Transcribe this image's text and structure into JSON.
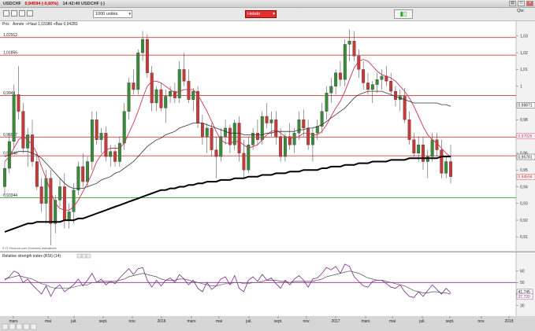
{
  "window": {
    "symbol": "USDCHF",
    "price": "0,94594",
    "change": "(-0,60%)",
    "time": "14:42:40 USDCHF",
    "suffix": "(-)",
    "quote_label": "Qte",
    "icons": [
      "chart-icon",
      "maximize-icon",
      "close-icon"
    ]
  },
  "toolbar": {
    "units_value": "1000 unités",
    "period_value": "Hebdo",
    "chart_button_icon": "candlestick-chart-icon"
  },
  "main_chart": {
    "panel_label": "Prix",
    "legend_text": "Année :+Haut 1,03386 +Bas 0,94283",
    "source_note": "© IT-Finance.com Données indicatives",
    "y_ticks": [
      {
        "v": 1.03,
        "label": "1,03"
      },
      {
        "v": 1.02,
        "label": "1,02"
      },
      {
        "v": 1.01,
        "label": "1,01"
      },
      {
        "v": 1.0,
        "label": "1"
      },
      {
        "v": 0.98,
        "label": "0,98"
      },
      {
        "v": 0.96,
        "label": "0,96"
      },
      {
        "v": 0.95,
        "label": "0,95"
      },
      {
        "v": 0.94,
        "label": "0,94"
      },
      {
        "v": 0.93,
        "label": "0,93"
      },
      {
        "v": 0.92,
        "label": "0,92"
      },
      {
        "v": 0.91,
        "label": "0,91"
      }
    ],
    "h_lines": [
      {
        "v": 1.02912,
        "label": "1,02912",
        "color": "#d23c3c"
      },
      {
        "v": 1.01856,
        "label": "1,01856",
        "color": "#d23c3c"
      },
      {
        "v": 0.9944,
        "label": "0,9944",
        "color": "#d23c3c"
      },
      {
        "v": 0.96967,
        "label": "0,96967",
        "color": "#d23c3c"
      },
      {
        "v": 0.95846,
        "label": "0,95846",
        "color": "#d23c3c"
      },
      {
        "v": 0.93344,
        "label": "0,93344",
        "color": "#3aa53a"
      }
    ],
    "right_badges": [
      {
        "v": 0.98871,
        "label": "0,98871",
        "bg": "#ffffff",
        "fg": "#222222"
      },
      {
        "v": 0.97026,
        "label": "0,97026",
        "bg": "#ffffff",
        "fg": "#cc2255"
      },
      {
        "v": 0.95781,
        "label": "0,95781",
        "bg": "#ffffff",
        "fg": "#222222"
      },
      {
        "v": 0.94594,
        "label": "0,94594",
        "bg": "#ffffff",
        "fg": "#cc2222"
      }
    ]
  },
  "chart_data": {
    "type": "candlestick",
    "title": "USDCHF",
    "xlabel": "",
    "ylabel": "",
    "ylim": [
      0.905,
      1.036
    ],
    "x": [
      "mars 2015",
      "mai",
      "juil.",
      "sept.",
      "nov.",
      "2016",
      "mars",
      "mai",
      "juil.",
      "sept.",
      "nov.",
      "2017",
      "mars",
      "mai",
      "juil.",
      "sept.",
      "nov.",
      "2018"
    ],
    "candles": [
      [
        0.94,
        0.955,
        0.935,
        0.951
      ],
      [
        0.951,
        0.972,
        0.948,
        0.967
      ],
      [
        0.967,
        1.001,
        0.963,
        0.995
      ],
      [
        0.995,
        1.012,
        0.98,
        0.985
      ],
      [
        0.985,
        0.99,
        0.96,
        0.963
      ],
      [
        0.963,
        0.975,
        0.952,
        0.971
      ],
      [
        0.971,
        0.98,
        0.952,
        0.955
      ],
      [
        0.955,
        0.96,
        0.938,
        0.94
      ],
      [
        0.94,
        0.945,
        0.925,
        0.93
      ],
      [
        0.93,
        0.95,
        0.918,
        0.945
      ],
      [
        0.945,
        0.95,
        0.905,
        0.918
      ],
      [
        0.918,
        0.935,
        0.912,
        0.932
      ],
      [
        0.932,
        0.945,
        0.928,
        0.94
      ],
      [
        0.94,
        0.948,
        0.915,
        0.92
      ],
      [
        0.92,
        0.93,
        0.915,
        0.925
      ],
      [
        0.925,
        0.942,
        0.918,
        0.938
      ],
      [
        0.938,
        0.955,
        0.935,
        0.952
      ],
      [
        0.952,
        0.96,
        0.94,
        0.943
      ],
      [
        0.943,
        0.958,
        0.94,
        0.955
      ],
      [
        0.955,
        0.985,
        0.95,
        0.98
      ],
      [
        0.98,
        0.985,
        0.965,
        0.968
      ],
      [
        0.968,
        0.975,
        0.96,
        0.972
      ],
      [
        0.972,
        0.976,
        0.955,
        0.958
      ],
      [
        0.958,
        0.965,
        0.952,
        0.961
      ],
      [
        0.961,
        0.965,
        0.952,
        0.955
      ],
      [
        0.955,
        0.97,
        0.952,
        0.966
      ],
      [
        0.966,
        0.99,
        0.962,
        0.985
      ],
      [
        0.985,
        1.005,
        0.98,
        1.002
      ],
      [
        1.002,
        1.01,
        0.995,
        0.998
      ],
      [
        0.998,
        1.022,
        0.995,
        1.02
      ],
      [
        1.02,
        1.033,
        1.015,
        1.028
      ],
      [
        1.028,
        1.031,
        1.005,
        1.008
      ],
      [
        1.008,
        1.012,
        0.985,
        0.99
      ],
      [
        0.99,
        1.0,
        0.985,
        0.998
      ],
      [
        0.998,
        1.002,
        0.985,
        0.987
      ],
      [
        0.987,
        0.998,
        0.978,
        0.994
      ],
      [
        0.994,
        1.0,
        0.99,
        0.997
      ],
      [
        0.997,
        1.002,
        0.99,
        0.993
      ],
      [
        0.993,
        1.015,
        0.99,
        1.01
      ],
      [
        1.01,
        1.02,
        1.0,
        1.003
      ],
      [
        1.003,
        1.01,
        0.99,
        0.992
      ],
      [
        0.992,
        0.999,
        0.985,
        0.997
      ],
      [
        0.997,
        1.0,
        0.975,
        0.978
      ],
      [
        0.978,
        0.983,
        0.965,
        0.97
      ],
      [
        0.97,
        0.978,
        0.96,
        0.975
      ],
      [
        0.975,
        0.978,
        0.958,
        0.962
      ],
      [
        0.962,
        0.97,
        0.945,
        0.958
      ],
      [
        0.958,
        0.975,
        0.955,
        0.97
      ],
      [
        0.97,
        0.98,
        0.965,
        0.975
      ],
      [
        0.975,
        0.977,
        0.96,
        0.965
      ],
      [
        0.965,
        0.98,
        0.962,
        0.978
      ],
      [
        0.978,
        0.982,
        0.955,
        0.96
      ],
      [
        0.96,
        0.968,
        0.945,
        0.95
      ],
      [
        0.95,
        0.97,
        0.948,
        0.965
      ],
      [
        0.965,
        0.975,
        0.962,
        0.972
      ],
      [
        0.972,
        0.98,
        0.965,
        0.968
      ],
      [
        0.968,
        0.985,
        0.965,
        0.982
      ],
      [
        0.982,
        0.99,
        0.975,
        0.978
      ],
      [
        0.978,
        0.985,
        0.97,
        0.98
      ],
      [
        0.98,
        0.985,
        0.965,
        0.97
      ],
      [
        0.97,
        0.975,
        0.955,
        0.958
      ],
      [
        0.958,
        0.972,
        0.955,
        0.97
      ],
      [
        0.97,
        0.978,
        0.962,
        0.965
      ],
      [
        0.965,
        0.975,
        0.96,
        0.972
      ],
      [
        0.972,
        0.985,
        0.968,
        0.98
      ],
      [
        0.98,
        0.986,
        0.97,
        0.975
      ],
      [
        0.975,
        0.98,
        0.962,
        0.965
      ],
      [
        0.965,
        0.975,
        0.955,
        0.972
      ],
      [
        0.972,
        0.98,
        0.968,
        0.976
      ],
      [
        0.976,
        0.99,
        0.972,
        0.985
      ],
      [
        0.985,
        1.0,
        0.98,
        0.996
      ],
      [
        0.996,
        1.005,
        0.99,
        1.0
      ],
      [
        1.0,
        1.01,
        0.995,
        1.008
      ],
      [
        1.008,
        1.015,
        1.0,
        1.004
      ],
      [
        1.004,
        1.028,
        1.0,
        1.025
      ],
      [
        1.025,
        1.034,
        1.015,
        1.027
      ],
      [
        1.027,
        1.033,
        1.015,
        1.018
      ],
      [
        1.018,
        1.022,
        1.005,
        1.01
      ],
      [
        1.01,
        1.015,
        0.998,
        1.002
      ],
      [
        1.002,
        1.008,
        0.995,
        0.998
      ],
      [
        0.998,
        1.003,
        0.99,
        1.001
      ],
      [
        1.001,
        1.008,
        0.996,
        1.004
      ],
      [
        1.004,
        1.01,
        0.998,
        1.006
      ],
      [
        1.006,
        1.012,
        1.0,
        1.003
      ],
      [
        1.003,
        1.008,
        0.995,
        0.997
      ],
      [
        0.997,
        1.0,
        0.988,
        0.992
      ],
      [
        0.992,
        0.998,
        0.985,
        0.994
      ],
      [
        0.994,
        0.999,
        0.978,
        0.98
      ],
      [
        0.98,
        0.985,
        0.965,
        0.968
      ],
      [
        0.968,
        0.972,
        0.958,
        0.96
      ],
      [
        0.96,
        0.97,
        0.955,
        0.965
      ],
      [
        0.965,
        0.97,
        0.95,
        0.955
      ],
      [
        0.955,
        0.962,
        0.945,
        0.958
      ],
      [
        0.958,
        0.972,
        0.955,
        0.968
      ],
      [
        0.968,
        0.972,
        0.958,
        0.962
      ],
      [
        0.962,
        0.968,
        0.945,
        0.948
      ],
      [
        0.948,
        0.958,
        0.945,
        0.955
      ],
      [
        0.955,
        0.965,
        0.942,
        0.946
      ]
    ],
    "series": [
      {
        "name": "moyenne courte",
        "color": "#cc3355",
        "values": [
          0.955,
          0.958,
          0.963,
          0.968,
          0.97,
          0.968,
          0.965,
          0.96,
          0.952,
          0.945,
          0.937,
          0.93,
          0.927,
          0.926,
          0.926,
          0.928,
          0.932,
          0.937,
          0.942,
          0.948,
          0.955,
          0.959,
          0.962,
          0.963,
          0.963,
          0.963,
          0.966,
          0.972,
          0.978,
          0.985,
          0.993,
          1.0,
          1.003,
          1.003,
          1.002,
          1.0,
          0.998,
          0.996,
          0.997,
          0.998,
          0.998,
          0.998,
          0.995,
          0.99,
          0.985,
          0.979,
          0.973,
          0.968,
          0.966,
          0.966,
          0.967,
          0.967,
          0.965,
          0.963,
          0.964,
          0.965,
          0.968,
          0.971,
          0.973,
          0.974,
          0.972,
          0.97,
          0.969,
          0.969,
          0.97,
          0.972,
          0.972,
          0.971,
          0.971,
          0.973,
          0.977,
          0.982,
          0.987,
          0.991,
          0.997,
          1.004,
          1.011,
          1.015,
          1.016,
          1.015,
          1.012,
          1.009,
          1.007,
          1.006,
          1.005,
          1.003,
          1.0,
          0.997,
          0.993,
          0.988,
          0.982,
          0.976,
          0.971,
          0.968,
          0.966,
          0.963,
          0.96,
          0.958
        ]
      },
      {
        "name": "moyenne moyenne",
        "color": "#333333",
        "values": [
          0.958,
          0.959,
          0.96,
          0.961,
          0.961,
          0.961,
          0.96,
          0.959,
          0.957,
          0.954,
          0.951,
          0.948,
          0.945,
          0.942,
          0.94,
          0.939,
          0.939,
          0.939,
          0.94,
          0.941,
          0.942,
          0.944,
          0.945,
          0.946,
          0.948,
          0.949,
          0.951,
          0.953,
          0.955,
          0.958,
          0.961,
          0.964,
          0.966,
          0.968,
          0.969,
          0.971,
          0.972,
          0.973,
          0.975,
          0.976,
          0.977,
          0.978,
          0.978,
          0.978,
          0.977,
          0.976,
          0.975,
          0.974,
          0.973,
          0.972,
          0.972,
          0.972,
          0.971,
          0.971,
          0.971,
          0.971,
          0.971,
          0.972,
          0.972,
          0.973,
          0.973,
          0.973,
          0.973,
          0.973,
          0.974,
          0.974,
          0.975,
          0.975,
          0.976,
          0.977,
          0.979,
          0.981,
          0.983,
          0.985,
          0.987,
          0.99,
          0.993,
          0.995,
          0.996,
          0.997,
          0.997,
          0.997,
          0.997,
          0.996,
          0.995,
          0.994,
          0.993,
          0.992,
          0.991,
          0.99,
          0.99,
          0.99,
          0.99,
          0.99,
          0.99,
          0.989,
          0.989,
          0.988
        ]
      },
      {
        "name": "moyenne longue",
        "color": "#000000",
        "values": [
          0.913,
          0.914,
          0.915,
          0.916,
          0.917,
          0.918,
          0.918,
          0.919,
          0.919,
          0.919,
          0.919,
          0.919,
          0.919,
          0.92,
          0.92,
          0.92,
          0.921,
          0.921,
          0.922,
          0.923,
          0.924,
          0.925,
          0.926,
          0.927,
          0.928,
          0.929,
          0.93,
          0.931,
          0.932,
          0.933,
          0.934,
          0.935,
          0.936,
          0.937,
          0.938,
          0.938,
          0.939,
          0.939,
          0.94,
          0.94,
          0.941,
          0.941,
          0.942,
          0.942,
          0.943,
          0.943,
          0.943,
          0.944,
          0.944,
          0.944,
          0.945,
          0.945,
          0.945,
          0.946,
          0.946,
          0.946,
          0.947,
          0.947,
          0.947,
          0.948,
          0.948,
          0.948,
          0.949,
          0.949,
          0.949,
          0.95,
          0.95,
          0.95,
          0.95,
          0.951,
          0.951,
          0.952,
          0.952,
          0.952,
          0.953,
          0.953,
          0.953,
          0.954,
          0.954,
          0.954,
          0.955,
          0.955,
          0.955,
          0.955,
          0.956,
          0.956,
          0.956,
          0.956,
          0.957,
          0.957,
          0.957,
          0.957,
          0.957,
          0.957,
          0.957,
          0.958,
          0.958,
          0.958
        ]
      }
    ]
  },
  "rsi": {
    "label": "Relative strength index (RSI) (14)",
    "y_ticks": [
      {
        "v": 60,
        "label": "60"
      },
      {
        "v": 50,
        "label": "50"
      },
      {
        "v": 40,
        "label": "40"
      },
      {
        "v": 30,
        "label": "30"
      }
    ],
    "level_line": 50,
    "badges": [
      {
        "v": 41.745,
        "label": "41,745"
      },
      {
        "v": 37.72,
        "label": "37,720"
      }
    ],
    "rsi_values": [
      52,
      55,
      60,
      58,
      50,
      53,
      48,
      44,
      40,
      47,
      38,
      45,
      48,
      42,
      45,
      48,
      53,
      47,
      52,
      58,
      50,
      53,
      48,
      51,
      49,
      54,
      58,
      62,
      57,
      62,
      63,
      52,
      46,
      52,
      47,
      52,
      54,
      50,
      57,
      53,
      48,
      52,
      45,
      42,
      50,
      44,
      47,
      53,
      55,
      48,
      56,
      45,
      42,
      52,
      55,
      51,
      57,
      52,
      54,
      49,
      45,
      52,
      48,
      53,
      56,
      52,
      46,
      53,
      54,
      58,
      63,
      61,
      64,
      58,
      66,
      64,
      55,
      51,
      47,
      46,
      51,
      52,
      52,
      49,
      46,
      45,
      48,
      42,
      38,
      37,
      42,
      38,
      43,
      48,
      44,
      40,
      45,
      41
    ],
    "signal_values": [
      53,
      54,
      55,
      56,
      55,
      54,
      53,
      51,
      49,
      48,
      46,
      45,
      45,
      45,
      45,
      46,
      47,
      48,
      48,
      50,
      50,
      51,
      51,
      51,
      51,
      52,
      53,
      55,
      56,
      57,
      58,
      57,
      56,
      55,
      53,
      52,
      52,
      52,
      53,
      53,
      52,
      51,
      50,
      49,
      48,
      47,
      47,
      48,
      49,
      49,
      50,
      50,
      49,
      49,
      50,
      50,
      51,
      52,
      52,
      52,
      51,
      51,
      50,
      51,
      51,
      51,
      51,
      51,
      52,
      53,
      55,
      56,
      57,
      58,
      59,
      60,
      59,
      58,
      56,
      54,
      53,
      52,
      52,
      51,
      50,
      49,
      48,
      47,
      45,
      43,
      42,
      41,
      41,
      42,
      42,
      41,
      41,
      40
    ]
  },
  "x_axis": {
    "labels": [
      "mars",
      "mai",
      "juil.",
      "sept.",
      "nov.",
      "2016",
      "mars",
      "mai",
      "juil.",
      "sept.",
      "nov.",
      "2017",
      "mars",
      "mai",
      "juil.",
      "sept.",
      "nov.",
      "2018"
    ],
    "bottom_icons": [
      "zoom-out-icon",
      "zoom-in-icon",
      "scroll-left-icon",
      "scroll-right-icon",
      "page-icon"
    ]
  }
}
